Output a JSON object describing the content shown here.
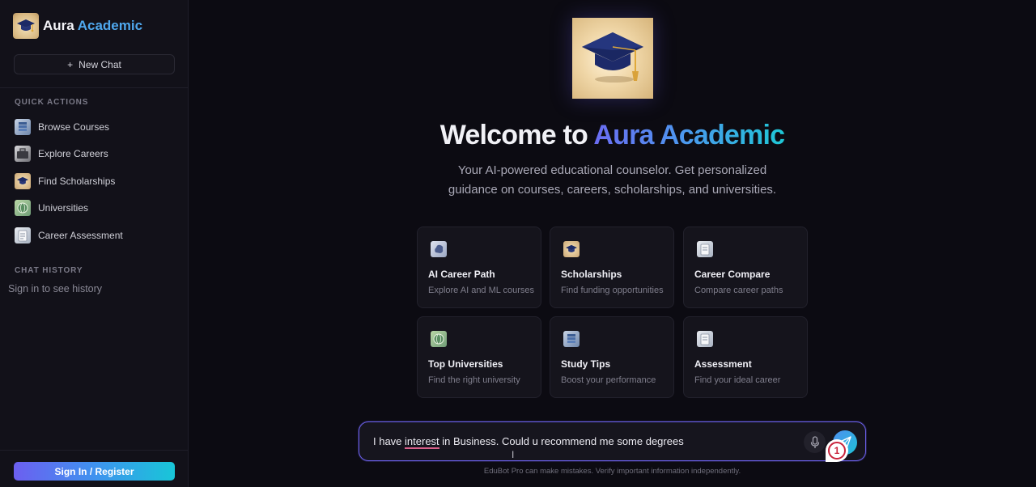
{
  "brand": {
    "name_a": "Aura",
    "name_b": "Academic"
  },
  "sidebar": {
    "new_chat_label": "New Chat",
    "quick_actions_label": "QUICK ACTIONS",
    "quick_actions": [
      {
        "label": "Browse Courses",
        "icon": "book-stack-icon"
      },
      {
        "label": "Explore Careers",
        "icon": "briefcase-icon"
      },
      {
        "label": "Find Scholarships",
        "icon": "graduation-cap-icon"
      },
      {
        "label": "Universities",
        "icon": "globe-icon"
      },
      {
        "label": "Career Assessment",
        "icon": "clipboard-icon"
      }
    ],
    "chat_history_label": "CHAT HISTORY",
    "history_note": "Sign in to see history",
    "signin_label": "Sign In / Register"
  },
  "main": {
    "welcome_prefix": "Welcome to",
    "welcome_brand": "Aura Academic",
    "subtitle": "Your AI-powered educational counselor. Get personalized guidance on courses, careers, scholarships, and universities.",
    "cards": [
      {
        "title": "AI Career Path",
        "desc": "Explore AI and ML courses",
        "icon": "brain-icon"
      },
      {
        "title": "Scholarships",
        "desc": "Find funding opportunities",
        "icon": "graduation-cap-icon"
      },
      {
        "title": "Career Compare",
        "desc": "Compare career paths",
        "icon": "clipboard-icon"
      },
      {
        "title": "Top Universities",
        "desc": "Find the right university",
        "icon": "globe-icon"
      },
      {
        "title": "Study Tips",
        "desc": "Boost your performance",
        "icon": "book-stack-icon"
      },
      {
        "title": "Assessment",
        "desc": "Find your ideal career",
        "icon": "clipboard-icon"
      }
    ],
    "input": {
      "pre": "I have ",
      "misspelled": "interest",
      "post": " in Business. Could u recommend me some degrees"
    },
    "badge_number": "1",
    "disclaimer": "EduBot Pro can make mistakes. Verify important information independently."
  },
  "colors": {
    "accent": "#6a5fe8",
    "brand_blue": "#4fa8ee",
    "badge_red": "#c9233b"
  }
}
